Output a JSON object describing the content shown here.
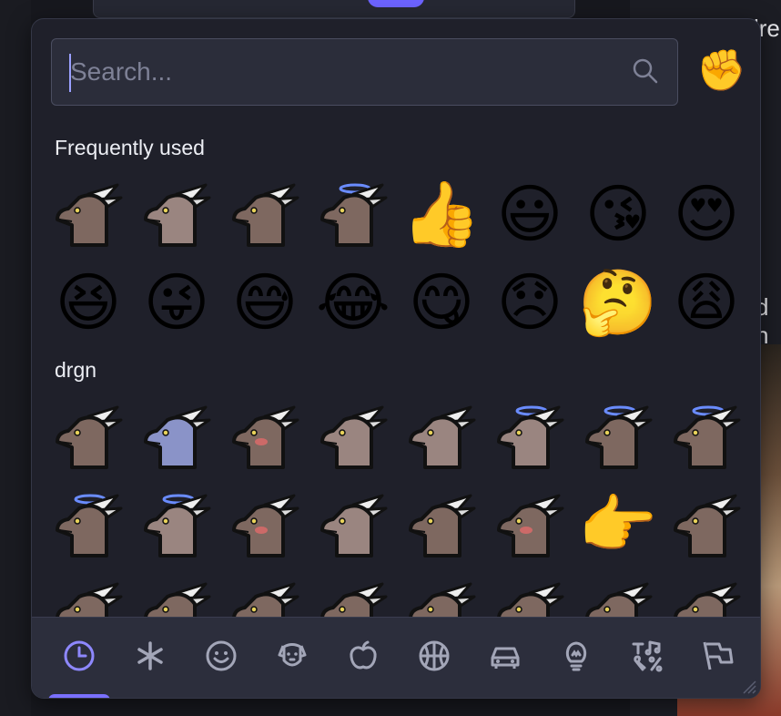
{
  "search": {
    "placeholder": "Search...",
    "value": ""
  },
  "skin_tone_glyph": "✊",
  "sections": [
    {
      "title": "Frequently used",
      "emojis": [
        "drgn-sparkle",
        "drgn-smug",
        "drgn-scream",
        "drgn-angel",
        "👍",
        "😃",
        "😘",
        "😍",
        "😆",
        "😜",
        "😅",
        "😂",
        "😋",
        "😞",
        "🤔",
        "😩"
      ]
    },
    {
      "title": "drgn",
      "emojis": [
        "drgn",
        "drgn-blue",
        "drgn-blush",
        "drgn-side",
        "drgn-flat",
        "drgn-halo",
        "drgn-halo-tongue",
        "drgn-halo-2",
        "drgn-halo-drool",
        "drgn-halo-nervous",
        "drgn-angry",
        "drgn-wave",
        "drgn-tongue",
        "drgn-sweat",
        "👉",
        "drgn-point",
        "drgn-bed",
        "drgn-toast",
        "drgn-a",
        "drgn-b",
        "drgn-c",
        "drgn-d",
        "drgn-e",
        "drgn-f"
      ]
    }
  ],
  "categories": [
    {
      "name": "recent",
      "icon": "clock-icon",
      "active": true
    },
    {
      "name": "custom",
      "icon": "asterisk-icon"
    },
    {
      "name": "smileys",
      "icon": "smile-icon"
    },
    {
      "name": "animals",
      "icon": "dog-icon"
    },
    {
      "name": "food",
      "icon": "apple-icon"
    },
    {
      "name": "activities",
      "icon": "basketball-icon"
    },
    {
      "name": "travel",
      "icon": "car-icon"
    },
    {
      "name": "objects",
      "icon": "lightbulb-icon"
    },
    {
      "name": "symbols",
      "icon": "symbols-icon"
    },
    {
      "name": "flags",
      "icon": "flag-icon"
    }
  ],
  "background": {
    "right_text_1": "lre",
    "right_text_2": "d h"
  },
  "colors": {
    "accent": "#7a70ff",
    "panel": "#1f202a",
    "bar": "#2c2e3c"
  }
}
